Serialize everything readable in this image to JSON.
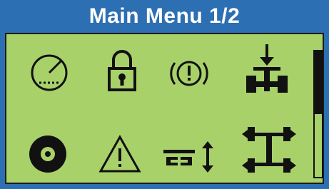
{
  "header": {
    "title": "Main Menu 1/2"
  },
  "menu": {
    "items": [
      {
        "icon": "gauge-icon"
      },
      {
        "icon": "padlock-icon"
      },
      {
        "icon": "brake-warning-icon"
      },
      {
        "icon": "axle-load-icon"
      },
      {
        "icon": "tire-icon"
      },
      {
        "icon": "warning-triangle-icon"
      },
      {
        "icon": "axle-lift-icon"
      },
      {
        "icon": "axle-config-icon"
      }
    ]
  },
  "scrollbar": {
    "position": 0.0,
    "visible_fraction": 0.5
  },
  "colors": {
    "header_bg": "#2d6fb3",
    "screen_bg": "#a9d16a",
    "ink": "#111111"
  }
}
